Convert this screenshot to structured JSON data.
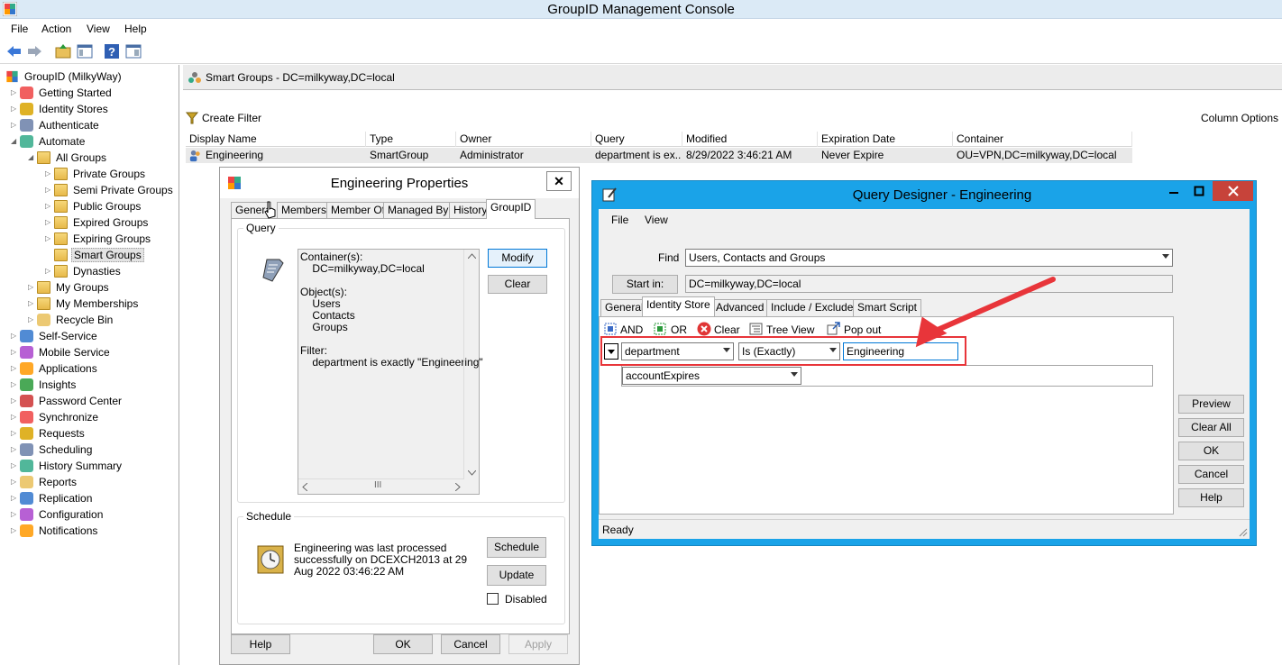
{
  "app": {
    "title": "GroupID Management Console",
    "menu": [
      "File",
      "Action",
      "View",
      "Help"
    ]
  },
  "tree": {
    "root": "GroupID (MilkyWay)",
    "items": [
      {
        "label": "Getting Started",
        "icon": "getting-started-icon"
      },
      {
        "label": "Identity Stores",
        "icon": "identity-stores-icon"
      },
      {
        "label": "Authenticate",
        "icon": "authenticate-icon"
      },
      {
        "label": "Automate",
        "icon": "automate-icon"
      },
      {
        "label": "All Groups",
        "icon": "folder-icon"
      },
      {
        "label": "Private Groups",
        "icon": "folder-icon"
      },
      {
        "label": "Semi Private Groups",
        "icon": "folder-icon"
      },
      {
        "label": "Public Groups",
        "icon": "folder-icon"
      },
      {
        "label": "Expired Groups",
        "icon": "folder-icon"
      },
      {
        "label": "Expiring Groups",
        "icon": "folder-icon"
      },
      {
        "label": "Smart Groups",
        "icon": "folder-icon"
      },
      {
        "label": "Dynasties",
        "icon": "folder-icon"
      },
      {
        "label": "My Groups",
        "icon": "folder-icon"
      },
      {
        "label": "My Memberships",
        "icon": "folder-icon"
      },
      {
        "label": "Recycle Bin",
        "icon": "recycle-bin-icon"
      },
      {
        "label": "Self-Service",
        "icon": "self-service-icon"
      },
      {
        "label": "Mobile Service",
        "icon": "mobile-service-icon"
      },
      {
        "label": "Applications",
        "icon": "applications-icon"
      },
      {
        "label": "Insights",
        "icon": "insights-icon"
      },
      {
        "label": "Password Center",
        "icon": "password-center-icon"
      },
      {
        "label": "Synchronize",
        "icon": "synchronize-icon"
      },
      {
        "label": "Requests",
        "icon": "requests-icon"
      },
      {
        "label": "Scheduling",
        "icon": "scheduling-icon"
      },
      {
        "label": "History Summary",
        "icon": "history-icon"
      },
      {
        "label": "Reports",
        "icon": "reports-icon"
      },
      {
        "label": "Replication",
        "icon": "replication-icon"
      },
      {
        "label": "Configuration",
        "icon": "configuration-icon"
      },
      {
        "label": "Notifications",
        "icon": "notifications-icon"
      }
    ]
  },
  "pane": {
    "header": "Smart Groups - DC=milkyway,DC=local",
    "create_filter": "Create Filter",
    "column_options": "Column Options",
    "columns": [
      "Display Name",
      "Type",
      "Owner",
      "Query",
      "Modified",
      "Expiration Date",
      "Container"
    ],
    "row": [
      "Engineering",
      "SmartGroup",
      "Administrator",
      "department is ex...",
      "8/29/2022 3:46:21 AM",
      "Never Expire",
      "OU=VPN,DC=milkyway,DC=local"
    ]
  },
  "props": {
    "title": "Engineering Properties",
    "close": "✕",
    "tabs": [
      "General",
      "Members",
      "Member Of",
      "Managed By",
      "History",
      "GroupID"
    ],
    "query_label": "Query",
    "query_lines": [
      "Container(s):",
      "    DC=milkyway,DC=local",
      "",
      "Object(s):",
      "    Users",
      "    Contacts",
      "    Groups",
      "",
      "Filter:",
      "    department is exactly \"Engineering\""
    ],
    "modify": "Modify",
    "clear": "Clear",
    "schedule_label": "Schedule",
    "schedule_text": "Engineering was last processed successfully on DCEXCH2013 at 29 Aug 2022 03:46:22 AM",
    "schedule_btn": "Schedule",
    "update_btn": "Update",
    "disabled": "Disabled",
    "help": "Help",
    "ok": "OK",
    "cancel": "Cancel",
    "apply": "Apply",
    "scroll_mid": "III"
  },
  "qd": {
    "title": "Query Designer - Engineering",
    "menu": [
      "File",
      "View"
    ],
    "find_label": "Find",
    "find_value": "Users, Contacts and Groups",
    "start_in_btn": "Start in:",
    "start_in_value": "DC=milkyway,DC=local",
    "tabs": [
      "General",
      "Identity Store",
      "Advanced",
      "Include / Exclude",
      "Smart Script"
    ],
    "toolbar": [
      "AND",
      "OR",
      "Clear",
      "Tree View",
      "Pop out"
    ],
    "row1": {
      "attribute": "department",
      "operator": "Is (Exactly)",
      "value": "Engineering"
    },
    "row2": {
      "attribute": "accountExpires"
    },
    "preview": "Preview",
    "clear_all": "Clear All",
    "ok": "OK",
    "cancel": "Cancel",
    "help": "Help",
    "status": "Ready"
  },
  "colors": {
    "annotation_red": "#e8353a",
    "qd_border": "#1aa3e8"
  }
}
